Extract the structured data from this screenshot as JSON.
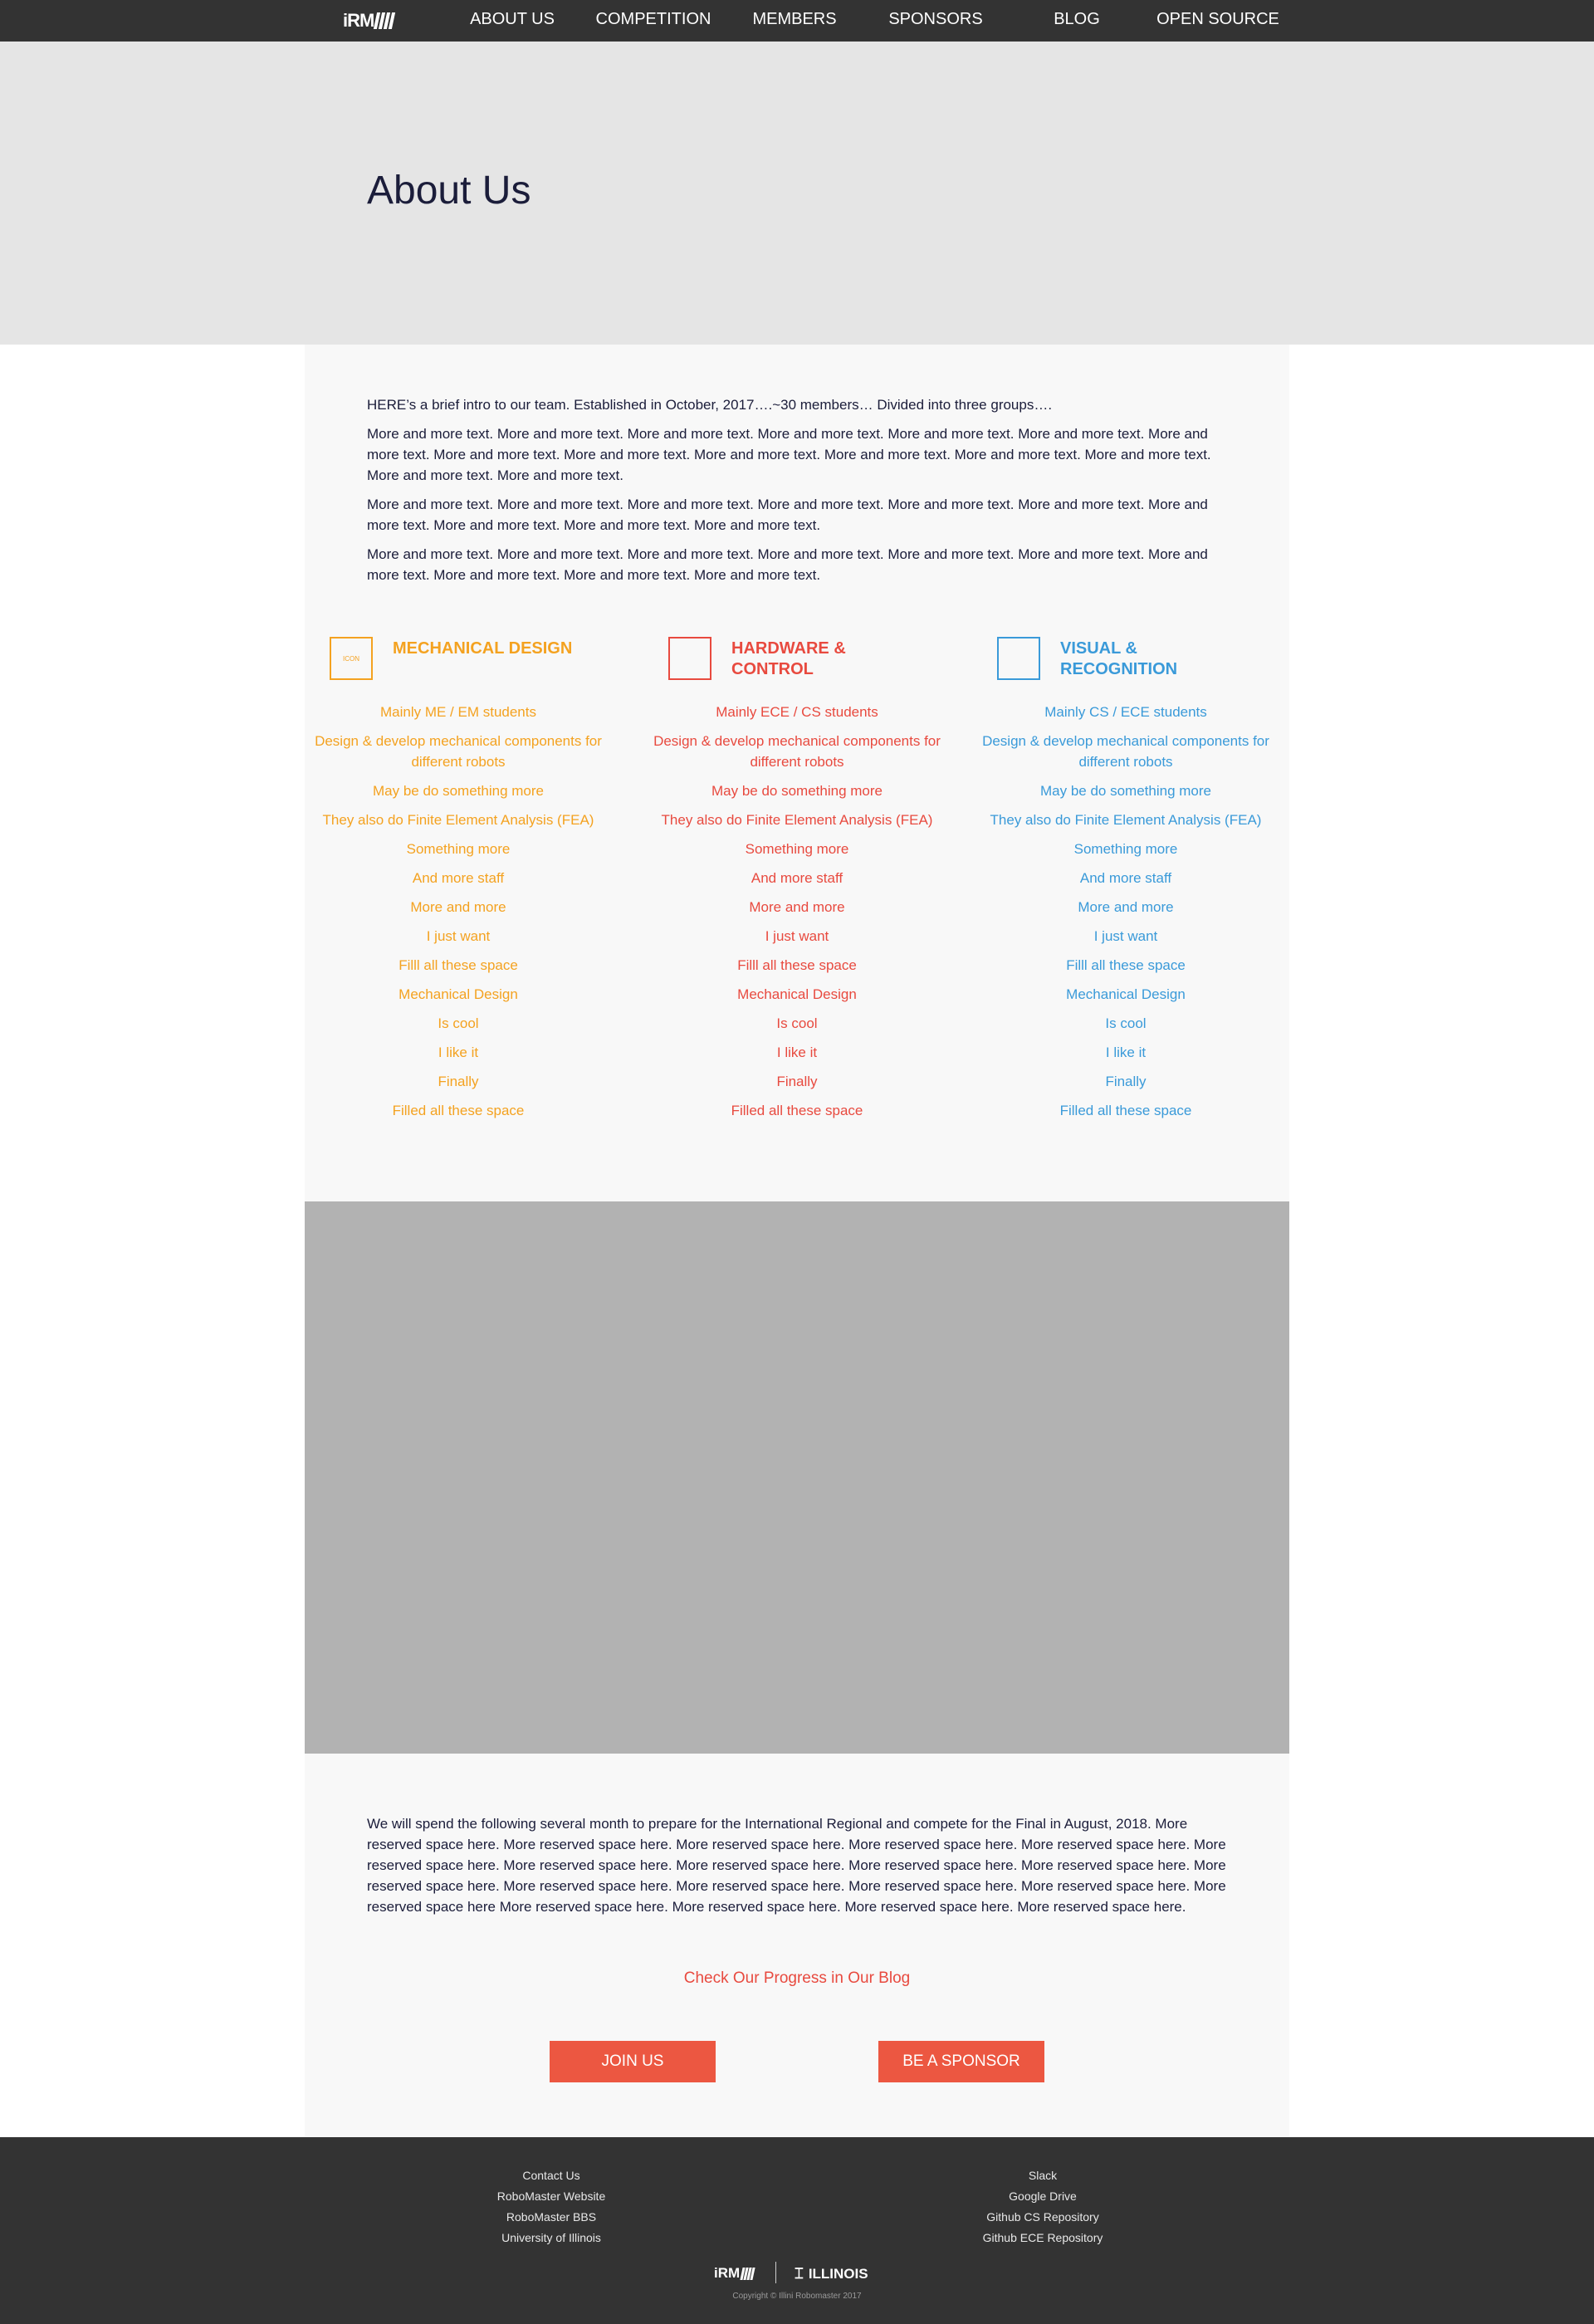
{
  "nav": {
    "logo": "iRM",
    "items": [
      {
        "label": "ABOUT US"
      },
      {
        "label": "COMPETITION"
      },
      {
        "label": "MEMBERS"
      },
      {
        "label": "SPONSORS"
      },
      {
        "label": "BLOG"
      },
      {
        "label": "OPEN SOURCE"
      }
    ]
  },
  "hero": {
    "title": "About Us"
  },
  "intro": {
    "lead": "HERE’s a brief intro to our team. Established in October, 2017….~30 members… Divided into three groups….",
    "paragraphs": [
      "More and more text. More and more text. More and more text. More and more text. More and more text. More and more text. More and more text. More and more text. More and more text. More and more text. More and more text. More and more text. More and more text. More and more text. More and more text.",
      "More and more text. More and more text. More and more text. More and more text. More and more text. More and more text. More and more text. More and more text. More and more text. More and more text.",
      "More and more text. More and more text. More and more text. More and more text. More and more text. More and more text. More and more text. More and more text. More and more text. More and more text."
    ]
  },
  "groups": [
    {
      "icon_label": "ICON",
      "title": "MECHANICAL DESIGN",
      "color": "#f4a220",
      "items": [
        "Mainly ME / EM students",
        "Design & develop mechanical components for different robots",
        "May be do something more",
        "They also do Finite Element Analysis (FEA)",
        "Something more",
        "And more staff",
        "More and more",
        "I just want",
        "Filll all these space",
        "Mechanical Design",
        "Is cool",
        "I like it",
        "Finally",
        "Filled all these space"
      ]
    },
    {
      "icon_label": "",
      "title": "HARDWARE & CONTROL",
      "color": "#e84a3f",
      "items": [
        "Mainly ECE / CS students",
        "Design & develop mechanical components for different robots",
        "May be do something more",
        "They also do Finite Element Analysis (FEA)",
        "Something more",
        "And more staff",
        "More and more",
        "I just want",
        "Filll all these space",
        "Mechanical Design",
        "Is cool",
        "I like it",
        "Finally",
        "Filled all these space"
      ]
    },
    {
      "icon_label": "",
      "title": "VISUAL & RECOGNITION",
      "color": "#3a9ad9",
      "items": [
        "Mainly CS / ECE students",
        "Design & develop mechanical components for different robots",
        "May be do something more",
        "They also do Finite Element Analysis (FEA)",
        "Something more",
        "And more staff",
        "More and more",
        "I just want",
        "Filll all these space",
        "Mechanical Design",
        "Is cool",
        "I like it",
        "Finally",
        "Filled all these space"
      ]
    }
  ],
  "plan": {
    "text": "We will spend the following several month to prepare for the International Regional and compete for the Final in August, 2018. More reserved space here. More reserved space here. More reserved space here. More reserved space here. More reserved space here. More reserved space here. More reserved space here. More reserved space here. More reserved space here. More reserved space here. More reserved space here. More reserved space here. More reserved space here. More reserved space here. More reserved space here. More reserved space here More reserved space here. More reserved space here. More reserved space here. More reserved space here.",
    "blog_link": "Check Our Progress in Our Blog",
    "join_button": "JOIN US",
    "sponsor_button": "BE A SPONSOR"
  },
  "footer": {
    "left_links": [
      "Contact Us",
      "RoboMaster Website",
      "RoboMaster BBS",
      "University of Illinois"
    ],
    "right_links": [
      "Slack",
      "Google Drive",
      "Github CS Repository",
      "Github ECE Repository"
    ],
    "logo_irm": "iRM",
    "logo_illinois": "ILLINOIS",
    "copyright": "Copyright © Illini Robomaster 2017"
  }
}
